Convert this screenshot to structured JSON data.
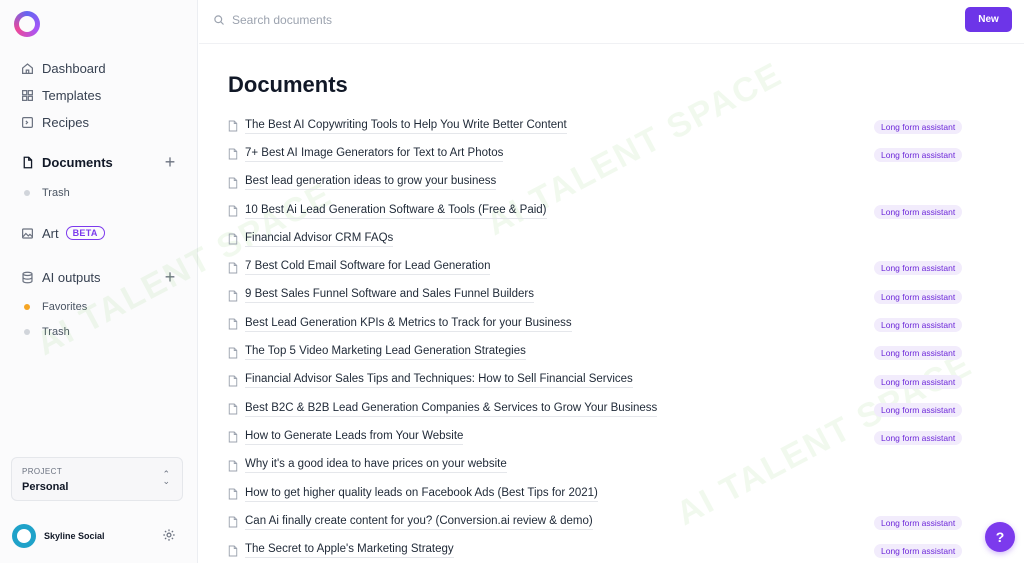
{
  "search": {
    "placeholder": "Search documents"
  },
  "header": {
    "new_label": "New"
  },
  "sidebar": {
    "nav": [
      {
        "label": "Dashboard",
        "icon": "home-icon"
      },
      {
        "label": "Templates",
        "icon": "grid-icon"
      },
      {
        "label": "Recipes",
        "icon": "recipe-icon"
      }
    ],
    "documents": {
      "label": "Documents",
      "trash_label": "Trash"
    },
    "art": {
      "label": "Art",
      "badge": "BETA"
    },
    "ai_outputs": {
      "label": "AI outputs",
      "favorites_label": "Favorites",
      "trash_label": "Trash"
    },
    "project": {
      "label": "PROJECT",
      "value": "Personal"
    },
    "user": {
      "name": "Skyline Social"
    }
  },
  "main": {
    "title": "Documents",
    "badge_label": "Long form assistant",
    "documents": [
      {
        "title": "The Best AI Copywriting Tools to Help You Write Better Content",
        "badge": true
      },
      {
        "title": "7+ Best AI Image Generators for Text to Art Photos",
        "badge": true
      },
      {
        "title": "Best lead generation ideas to grow your business",
        "badge": false
      },
      {
        "title": "10 Best Ai Lead Generation Software & Tools (Free & Paid)",
        "badge": true
      },
      {
        "title": "Financial Advisor CRM FAQs",
        "badge": false
      },
      {
        "title": "7 Best Cold Email Software for Lead Generation",
        "badge": true
      },
      {
        "title": "9 Best Sales Funnel Software and Sales Funnel Builders",
        "badge": true
      },
      {
        "title": "Best Lead Generation KPIs & Metrics to Track for your Business",
        "badge": true
      },
      {
        "title": "The Top 5 Video Marketing Lead Generation Strategies",
        "badge": true
      },
      {
        "title": "Financial Advisor Sales Tips and Techniques: How to Sell Financial Services",
        "badge": true
      },
      {
        "title": "Best B2C & B2B Lead Generation Companies & Services to Grow Your Business",
        "badge": true
      },
      {
        "title": "How to Generate Leads from Your Website",
        "badge": true
      },
      {
        "title": "Why it's a good idea to have prices on your website",
        "badge": false
      },
      {
        "title": "How to get higher quality leads on Facebook Ads (Best Tips for 2021)",
        "badge": false
      },
      {
        "title": "Can Ai finally create content for you? (Conversion.ai review & demo)",
        "badge": true
      },
      {
        "title": "The Secret to Apple's Marketing Strategy",
        "badge": true
      }
    ]
  },
  "help": {
    "label": "?"
  },
  "watermark": {
    "text": "AI TALENT SPACE"
  },
  "colors": {
    "accent": "#6d35e8",
    "badge_bg": "#f2ecfc",
    "badge_text": "#6d28d9",
    "favorite_dot": "#f5a524"
  }
}
